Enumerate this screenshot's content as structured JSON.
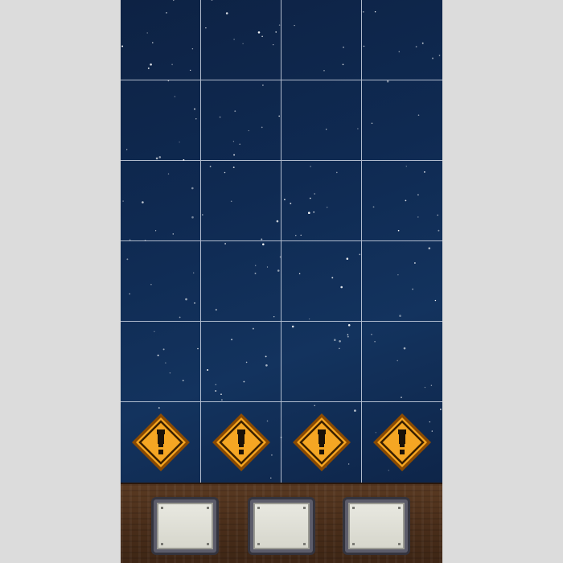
{
  "game": {
    "board": {
      "columns": 4,
      "rows": 6,
      "warning_row": 6,
      "warning_cells": [
        {
          "column": 1,
          "icon": "warning-exclamation-icon"
        },
        {
          "column": 2,
          "icon": "warning-exclamation-icon"
        },
        {
          "column": 3,
          "icon": "warning-exclamation-icon"
        },
        {
          "column": 4,
          "icon": "warning-exclamation-icon"
        }
      ]
    },
    "tray": {
      "slots": [
        {
          "label": ""
        },
        {
          "label": ""
        },
        {
          "label": ""
        }
      ]
    },
    "colors": {
      "page_background": "#dcdcdc",
      "sky": "#0f2a52",
      "grid_lines": "#e6ebf5",
      "warning_fill": "#f5a623",
      "warning_border": "#8a4a00",
      "shelf_wood": "#4a2e1a",
      "slot_frame": "#5c5c6a",
      "slot_face": "#e0e0d8"
    }
  }
}
